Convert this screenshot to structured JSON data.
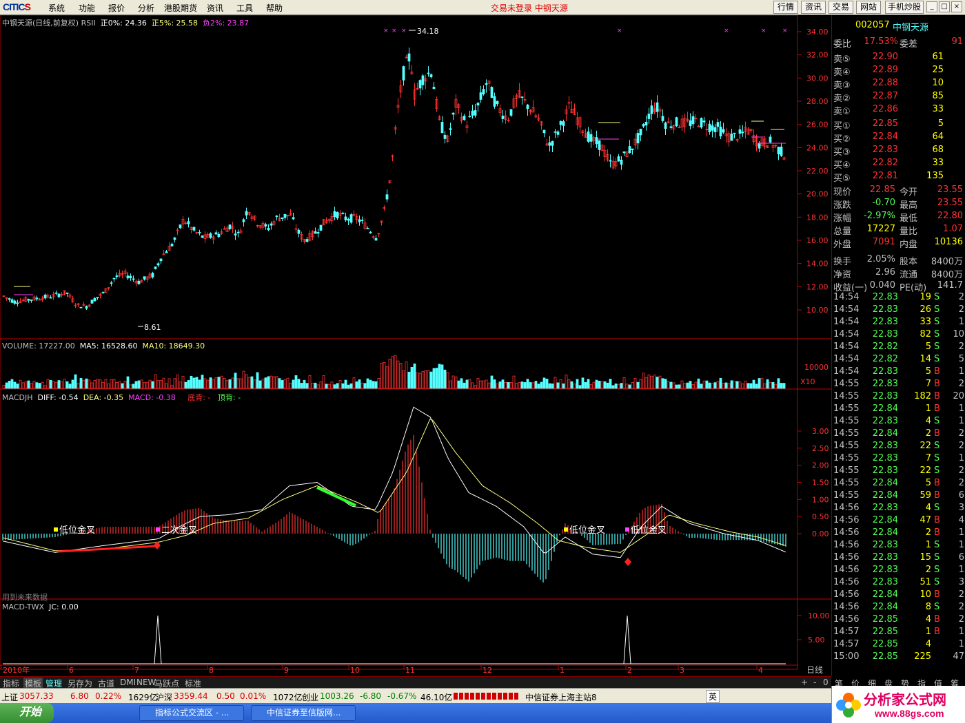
{
  "menubar": {
    "logo_text": "CITIC",
    "logo_s": "S",
    "items": [
      "系统",
      "功能",
      "报价",
      "分析",
      "港股期货",
      "资讯",
      "工具",
      "帮助"
    ],
    "center_status": "交易未登录  中钢天源",
    "buttons": [
      "行情",
      "资讯",
      "交易",
      "网站",
      "手机炒股"
    ],
    "win_controls": [
      "_",
      "□",
      "×"
    ]
  },
  "chart": {
    "title": "中钢天源(日线,前复权)",
    "indicator": "RSII",
    "pos0_label": "正0%: 24.36",
    "pos5_label": "正5%: 25.58",
    "neg2_label": "负2%: 23.87",
    "price_axis": [
      "34.00",
      "32.00",
      "30.00",
      "28.00",
      "26.00",
      "24.00",
      "22.00",
      "20.00",
      "18.00",
      "16.00",
      "14.00",
      "12.00",
      "10.00"
    ],
    "high_label": "34.18",
    "low_label": "8.61",
    "volume": {
      "title": "VOLUME: 17227.00",
      "ma5": "MA5: 16528.60",
      "ma10": "MA10: 18649.30",
      "axis_label": "10000",
      "unit": "X10"
    },
    "macd": {
      "title": "MACDJH",
      "diff": "DIFF: -0.54",
      "dea": "DEA: -0.35",
      "macd": "MACD: -0.38",
      "bottom_div": "底背: -",
      "top_div": "顶背: -",
      "axis": [
        "3.00",
        "2.50",
        "2.00",
        "1.50",
        "1.00",
        "0.50",
        "0.00"
      ],
      "signals": [
        "低位金叉",
        "二次金叉",
        "低位金叉",
        "低位金叉"
      ],
      "footnote": "用到未来数据"
    },
    "twx": {
      "title": "MACD-TWX",
      "jc": "JC: 0.00",
      "axis": [
        "10.00",
        "5.00"
      ]
    },
    "time_axis": [
      "2010年",
      "6",
      "7",
      "8",
      "9",
      "10",
      "11",
      "12",
      "1",
      "2",
      "3",
      "4"
    ],
    "period": "日线"
  },
  "quote": {
    "code": "002057",
    "name": "中钢天源",
    "weibi_label": "委比",
    "weibi_value": "17.53%",
    "weicha_label": "委差",
    "weicha_value": "91",
    "asks": [
      {
        "label": "卖⑤",
        "price": "22.90",
        "vol": "61"
      },
      {
        "label": "卖④",
        "price": "22.89",
        "vol": "25"
      },
      {
        "label": "卖③",
        "price": "22.88",
        "vol": "10"
      },
      {
        "label": "卖②",
        "price": "22.87",
        "vol": "85"
      },
      {
        "label": "卖①",
        "price": "22.86",
        "vol": "33"
      }
    ],
    "bids": [
      {
        "label": "买①",
        "price": "22.85",
        "vol": "5"
      },
      {
        "label": "买②",
        "price": "22.84",
        "vol": "64"
      },
      {
        "label": "买③",
        "price": "22.83",
        "vol": "68"
      },
      {
        "label": "买④",
        "price": "22.82",
        "vol": "33"
      },
      {
        "label": "买⑤",
        "price": "22.81",
        "vol": "135"
      }
    ],
    "stats": [
      {
        "l1": "现价",
        "v1": "22.85",
        "l2": "今开",
        "v2": "23.55"
      },
      {
        "l1": "涨跌",
        "v1": "-0.70",
        "l2": "最高",
        "v2": "23.55"
      },
      {
        "l1": "涨幅",
        "v1": "-2.97%",
        "l2": "最低",
        "v2": "22.80"
      },
      {
        "l1": "总量",
        "v1": "17227",
        "l2": "量比",
        "v2": "1.07"
      },
      {
        "l1": "外盘",
        "v1": "7091",
        "l2": "内盘",
        "v2": "10136"
      },
      {
        "l1": "换手",
        "v1": "2.05%",
        "l2": "股本",
        "v2": "8400万"
      },
      {
        "l1": "净资",
        "v1": "2.96",
        "l2": "流通",
        "v2": "8400万"
      },
      {
        "l1": "收益(一)",
        "v1": "0.040",
        "l2": "PE(动)",
        "v2": "141.7"
      }
    ],
    "ticks": [
      [
        "14:54",
        "22.83",
        "19",
        "S",
        "2"
      ],
      [
        "14:54",
        "22.83",
        "26",
        "S",
        "2"
      ],
      [
        "14:54",
        "22.83",
        "33",
        "S",
        "1"
      ],
      [
        "14:54",
        "22.83",
        "82",
        "S",
        "10"
      ],
      [
        "14:54",
        "22.82",
        "5",
        "S",
        "2"
      ],
      [
        "14:54",
        "22.82",
        "14",
        "S",
        "5"
      ],
      [
        "14:54",
        "22.83",
        "5",
        "B",
        "1"
      ],
      [
        "14:55",
        "22.83",
        "7",
        "B",
        "2"
      ],
      [
        "14:55",
        "22.83",
        "182",
        "B",
        "20"
      ],
      [
        "14:55",
        "22.84",
        "1",
        "B",
        "1"
      ],
      [
        "14:55",
        "22.83",
        "4",
        "S",
        "1"
      ],
      [
        "14:55",
        "22.84",
        "2",
        "B",
        "2"
      ],
      [
        "14:55",
        "22.83",
        "22",
        "S",
        "2"
      ],
      [
        "14:55",
        "22.83",
        "7",
        "S",
        "1"
      ],
      [
        "14:55",
        "22.83",
        "22",
        "S",
        "2"
      ],
      [
        "14:55",
        "22.84",
        "5",
        "B",
        "2"
      ],
      [
        "14:55",
        "22.84",
        "59",
        "B",
        "6"
      ],
      [
        "14:56",
        "22.83",
        "4",
        "S",
        "3"
      ],
      [
        "14:56",
        "22.84",
        "47",
        "B",
        "4"
      ],
      [
        "14:56",
        "22.84",
        "2",
        "B",
        "1"
      ],
      [
        "14:56",
        "22.83",
        "1",
        "S",
        "1"
      ],
      [
        "14:56",
        "22.83",
        "15",
        "S",
        "6"
      ],
      [
        "14:56",
        "22.83",
        "2",
        "S",
        "1"
      ],
      [
        "14:56",
        "22.83",
        "51",
        "S",
        "3"
      ],
      [
        "14:56",
        "22.84",
        "10",
        "B",
        "2"
      ],
      [
        "14:56",
        "22.84",
        "8",
        "S",
        "2"
      ],
      [
        "14:56",
        "22.85",
        "4",
        "B",
        "2"
      ],
      [
        "14:57",
        "22.85",
        "1",
        "B",
        "1"
      ],
      [
        "14:57",
        "22.85",
        "4",
        "",
        "1"
      ],
      [
        "15:00",
        "22.85",
        "225",
        "",
        "47"
      ]
    ],
    "side_tabs": [
      "笔",
      "价",
      "细",
      "盘",
      "势",
      "指",
      "值",
      "筹"
    ]
  },
  "bottom_tabs": [
    "指标",
    "模板",
    "管理",
    "另存为",
    "古道",
    "DMI",
    "NEW",
    "马跃点",
    "标准"
  ],
  "bottom_ctrl": [
    "+",
    "-",
    "0"
  ],
  "status": {
    "sh_label": "上证",
    "sh_value": "3057.33",
    "sh_chg": "6.80",
    "sh_pct": "0.22%",
    "sh_amt": "1629亿",
    "sz_label": "沪深",
    "sz_value": "3359.44",
    "sz_chg": "0.50",
    "sz_pct": "0.01%",
    "sz_amt": "1072亿",
    "cy_label": "创业",
    "cy_value": "1003.26",
    "cy_chg": "-6.80",
    "cy_pct": "-0.67%",
    "cy_amt": "46.10亿",
    "server": "中信证券上海主站8",
    "ime": "英"
  },
  "taskbar": {
    "start": "开始",
    "items": [
      "指标公式交流区 - ...",
      "中信证券至信版网..."
    ]
  },
  "site": {
    "name": "分析家公式网",
    "url": "www.88gs.com"
  },
  "colors": {
    "up": "#ff3232",
    "down": "#54ffff",
    "ma": "#ffff80",
    "diff": "#ffffff",
    "axis": "#c00000"
  }
}
